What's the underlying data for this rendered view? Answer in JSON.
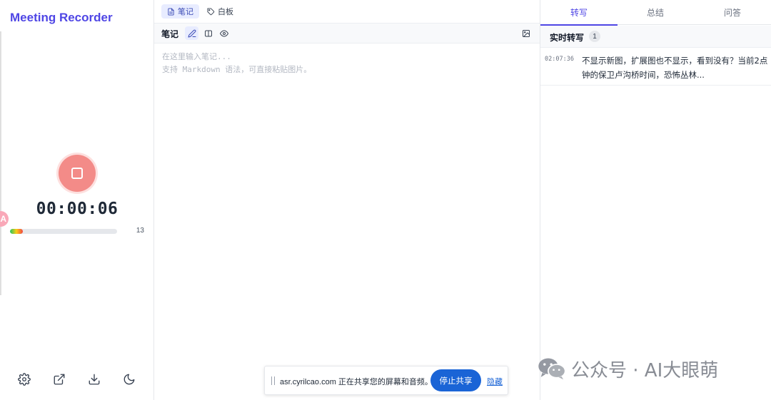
{
  "app": {
    "title": "Meeting Recorder"
  },
  "recorder": {
    "timer": "00:00:06",
    "level_count": "13",
    "level_fraction": 0.12,
    "avatar_letter": "A"
  },
  "sidebar_footer": {
    "icons": [
      "gear-icon",
      "external-link-icon",
      "download-icon",
      "moon-icon"
    ]
  },
  "notes": {
    "tabs": [
      {
        "label": "笔记",
        "icon": "document-icon",
        "active": true
      },
      {
        "label": "白板",
        "icon": "tag-icon",
        "active": false
      }
    ],
    "toolbar_title": "笔记",
    "placeholder_line1": "在这里输入笔记...",
    "placeholder_line2": "支持 Markdown 语法，可直接粘贴图片。"
  },
  "right_panel": {
    "tabs": [
      {
        "label": "转写",
        "active": true
      },
      {
        "label": "总结",
        "active": false
      },
      {
        "label": "问答",
        "active": false
      }
    ],
    "transcript_title": "实时转写",
    "transcript_count": "1",
    "entries": [
      {
        "time": "02:07:36",
        "text": "不显示新图，扩展图也不显示，看到没有？当前2点钟的保卫卢沟桥时间，恐怖丛林..."
      }
    ]
  },
  "share_bar": {
    "message": "asr.cyrilcao.com 正在共享您的屏幕和音频。",
    "stop_label": "停止共享",
    "hide_label": "隐藏"
  },
  "watermark": {
    "text": "公众号 · AI大眼萌"
  },
  "colors": {
    "brand": "#4f46e5",
    "record": "#f38b88",
    "share_button": "#1a64d6"
  }
}
